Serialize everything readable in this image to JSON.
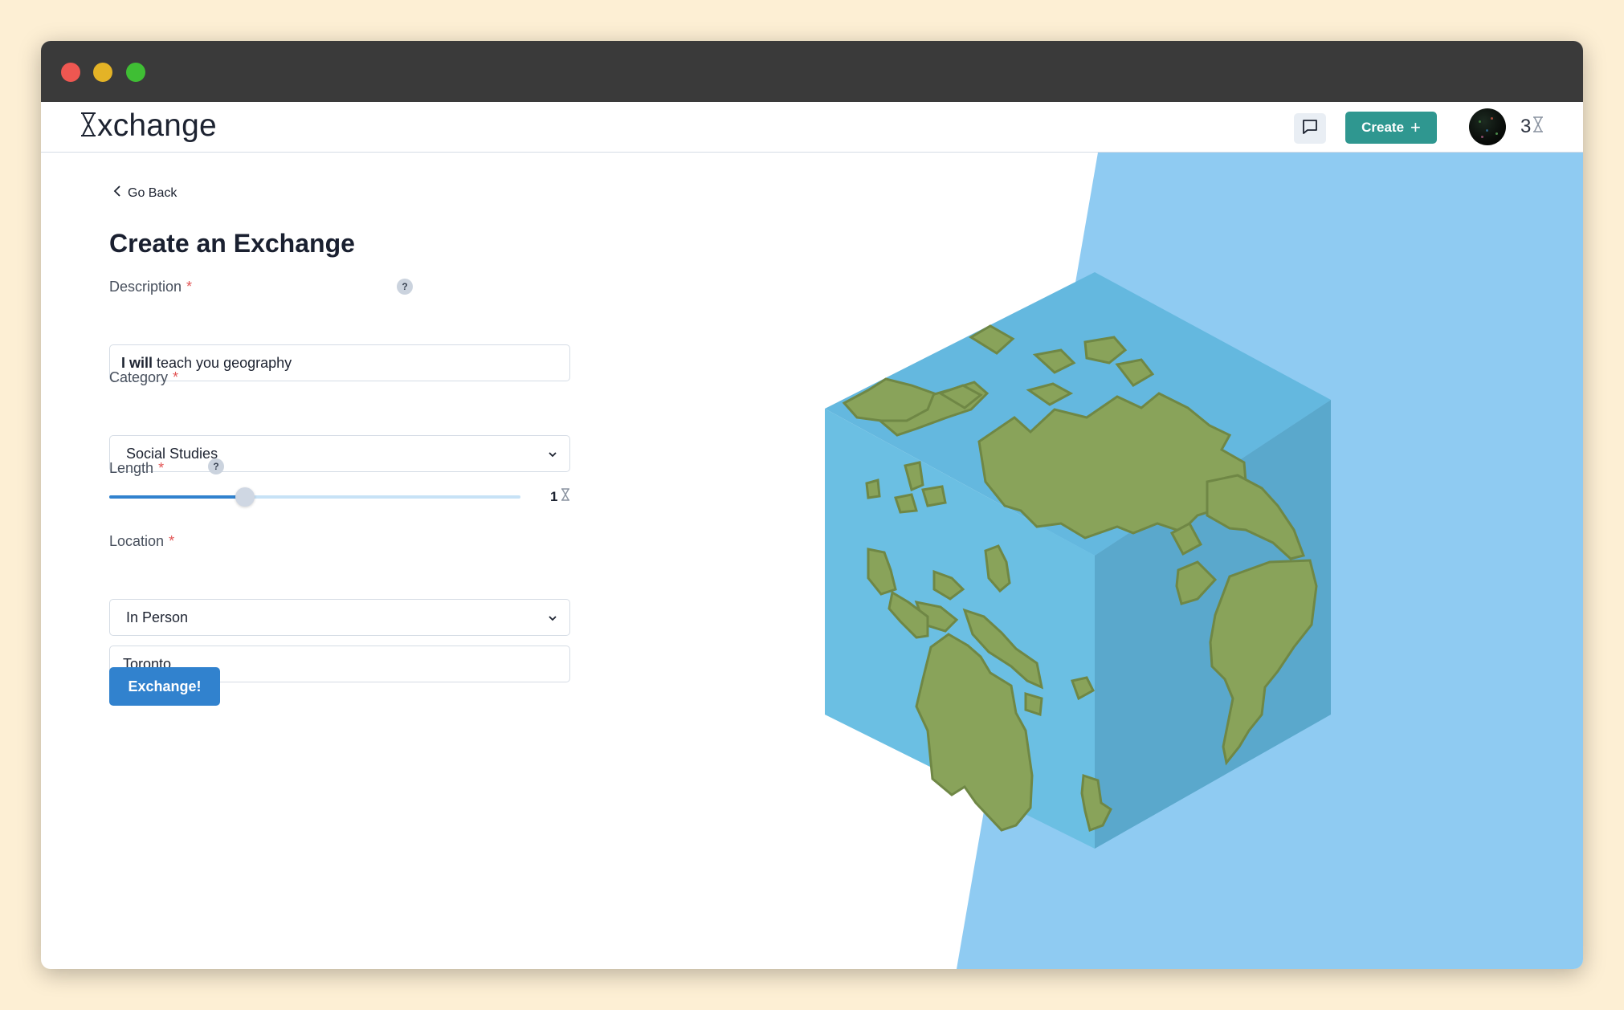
{
  "app": {
    "name_rest": "xchange",
    "nav": {
      "create_label": "Create",
      "create_icon": "plus-icon",
      "chat_icon": "message-square-icon",
      "credits": "3",
      "credits_icon": "hourglass-icon"
    }
  },
  "page": {
    "back_label": "Go Back",
    "title": "Create an Exchange",
    "help_glyph": "?"
  },
  "form": {
    "description": {
      "label": "Description",
      "required_mark": "*",
      "value_bold": "I will",
      "value_rest": " teach you geography"
    },
    "category": {
      "label": "Category",
      "required_mark": "*",
      "selected": "Social Studies"
    },
    "length": {
      "label": "Length",
      "required_mark": "*",
      "help_glyph": "?",
      "value": "1",
      "fraction": 0.33
    },
    "location": {
      "label": "Location",
      "required_mark": "*",
      "selected": "In Person",
      "city": "Toronto"
    },
    "submit_label": "Exchange!"
  },
  "colors": {
    "brand_teal": "#2f9790",
    "primary_blue": "#3182ce",
    "sky": "#8fcbf2",
    "land": "#89a35a",
    "ocean": "#64b8df"
  },
  "illustration": {
    "name": "voxel-earth-cube"
  }
}
